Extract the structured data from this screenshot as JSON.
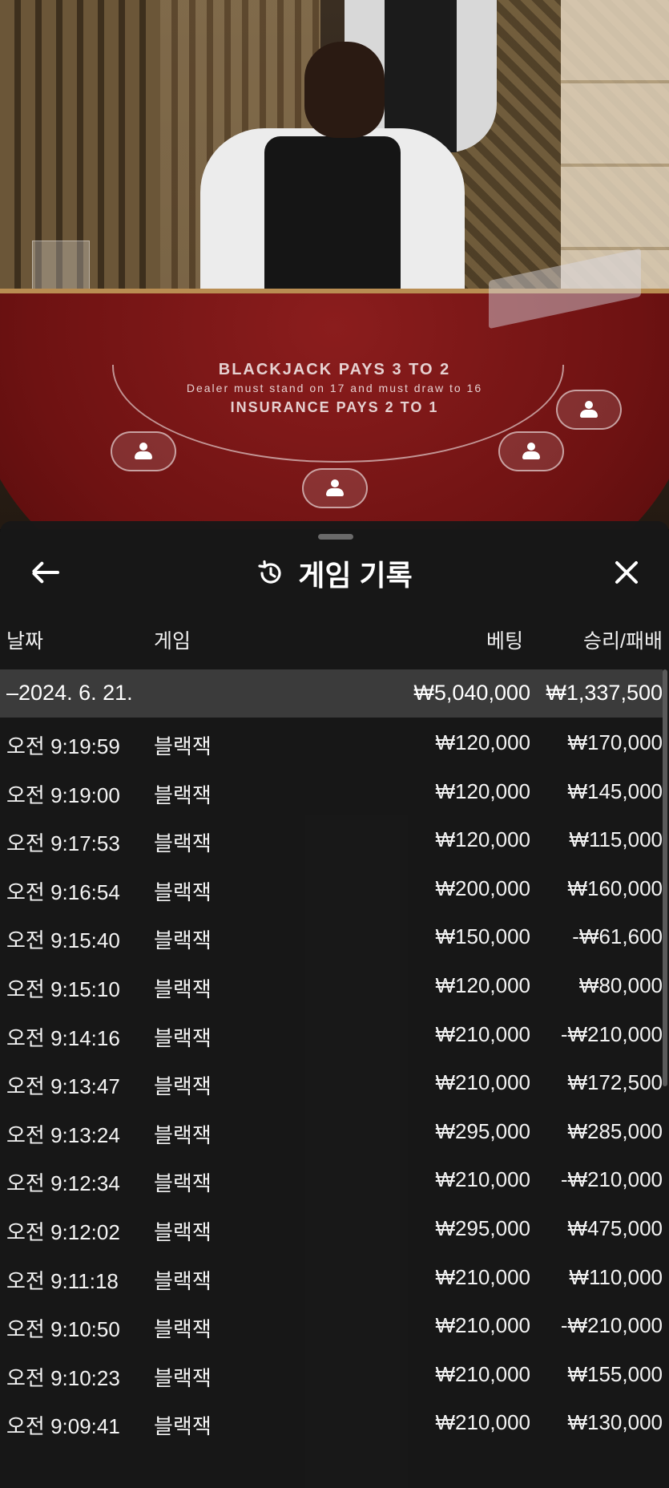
{
  "scene": {
    "felt_line1": "BLACKJACK PAYS 3 TO 2",
    "felt_line2": "Dealer must stand on 17 and must draw to 16",
    "felt_line3": "INSURANCE PAYS 2 TO 1"
  },
  "header": {
    "title": "게임 기록",
    "back_icon": "arrow-left-icon",
    "history_icon": "history-icon",
    "close_icon": "close-icon"
  },
  "columns": {
    "date": "날짜",
    "game": "게임",
    "bet": "베팅",
    "winloss": "승리/패배"
  },
  "group": {
    "date": "–2024. 6. 21.",
    "bet_total": "₩5,040,000",
    "winloss_total": "₩1,337,500"
  },
  "rows": [
    {
      "time": "오전 9:19:59",
      "game": "블랙잭",
      "bet": "₩120,000",
      "winloss": "₩170,000"
    },
    {
      "time": "오전 9:19:00",
      "game": "블랙잭",
      "bet": "₩120,000",
      "winloss": "₩145,000"
    },
    {
      "time": "오전 9:17:53",
      "game": "블랙잭",
      "bet": "₩120,000",
      "winloss": "₩115,000"
    },
    {
      "time": "오전 9:16:54",
      "game": "블랙잭",
      "bet": "₩200,000",
      "winloss": "₩160,000"
    },
    {
      "time": "오전 9:15:40",
      "game": "블랙잭",
      "bet": "₩150,000",
      "winloss": "-₩61,600"
    },
    {
      "time": "오전 9:15:10",
      "game": "블랙잭",
      "bet": "₩120,000",
      "winloss": "₩80,000"
    },
    {
      "time": "오전 9:14:16",
      "game": "블랙잭",
      "bet": "₩210,000",
      "winloss": "-₩210,000"
    },
    {
      "time": "오전 9:13:47",
      "game": "블랙잭",
      "bet": "₩210,000",
      "winloss": "₩172,500"
    },
    {
      "time": "오전 9:13:24",
      "game": "블랙잭",
      "bet": "₩295,000",
      "winloss": "₩285,000"
    },
    {
      "time": "오전 9:12:34",
      "game": "블랙잭",
      "bet": "₩210,000",
      "winloss": "-₩210,000"
    },
    {
      "time": "오전 9:12:02",
      "game": "블랙잭",
      "bet": "₩295,000",
      "winloss": "₩475,000"
    },
    {
      "time": "오전 9:11:18",
      "game": "블랙잭",
      "bet": "₩210,000",
      "winloss": "₩110,000"
    },
    {
      "time": "오전 9:10:50",
      "game": "블랙잭",
      "bet": "₩210,000",
      "winloss": "-₩210,000"
    },
    {
      "time": "오전 9:10:23",
      "game": "블랙잭",
      "bet": "₩210,000",
      "winloss": "₩155,000"
    },
    {
      "time": "오전 9:09:41",
      "game": "블랙잭",
      "bet": "₩210,000",
      "winloss": "₩130,000"
    }
  ]
}
